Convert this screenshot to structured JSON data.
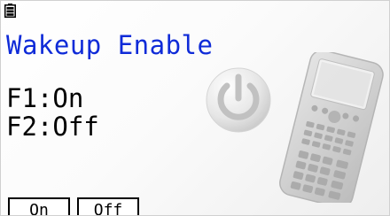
{
  "status": {
    "battery_icon": "battery-icon"
  },
  "screen": {
    "title": "Wakeup Enable",
    "options": [
      "F1:On",
      "F2:Off"
    ]
  },
  "function_keys": [
    {
      "label": "On"
    },
    {
      "label": "Off"
    }
  ],
  "colors": {
    "title": "#0f2bd8",
    "text": "#000000",
    "background": "#ffffff"
  },
  "decor": {
    "power_icon": "power-icon",
    "calculator_image": "calculator-illustration"
  }
}
